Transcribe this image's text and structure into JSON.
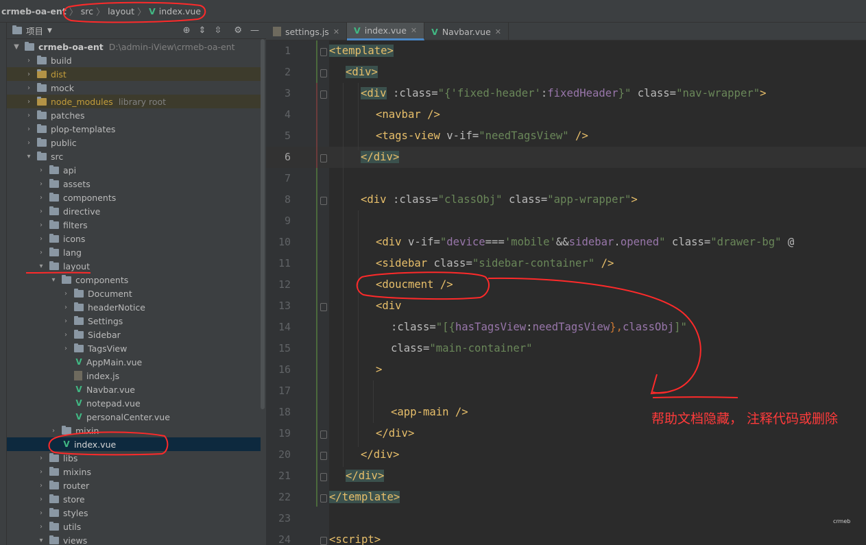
{
  "breadcrumb": {
    "root": "crmeb-oa-ent",
    "src": "src",
    "layout": "layout",
    "file": "index.vue",
    "sep": "〉",
    "file_icon": "V"
  },
  "project": {
    "title": "项目",
    "root_name": "crmeb-oa-ent",
    "root_path": "D:\\admin-iView\\crmeb-oa-ent",
    "items": [
      {
        "label": "build",
        "hint": ""
      },
      {
        "label": "dist",
        "hint": ""
      },
      {
        "label": "mock",
        "hint": ""
      },
      {
        "label": "node_modules",
        "hint": "library root"
      },
      {
        "label": "patches",
        "hint": ""
      },
      {
        "label": "plop-templates",
        "hint": ""
      },
      {
        "label": "public",
        "hint": ""
      },
      {
        "label": "src",
        "hint": ""
      },
      {
        "label": "api",
        "hint": ""
      },
      {
        "label": "assets",
        "hint": ""
      },
      {
        "label": "components",
        "hint": ""
      },
      {
        "label": "directive",
        "hint": ""
      },
      {
        "label": "filters",
        "hint": ""
      },
      {
        "label": "icons",
        "hint": ""
      },
      {
        "label": "lang",
        "hint": ""
      },
      {
        "label": "layout",
        "hint": ""
      },
      {
        "label": "components",
        "hint": ""
      },
      {
        "label": "Document",
        "hint": ""
      },
      {
        "label": "headerNotice",
        "hint": ""
      },
      {
        "label": "Settings",
        "hint": ""
      },
      {
        "label": "Sidebar",
        "hint": ""
      },
      {
        "label": "TagsView",
        "hint": ""
      },
      {
        "label": "AppMain.vue",
        "hint": ""
      },
      {
        "label": "index.js",
        "hint": ""
      },
      {
        "label": "Navbar.vue",
        "hint": ""
      },
      {
        "label": "notepad.vue",
        "hint": ""
      },
      {
        "label": "personalCenter.vue",
        "hint": ""
      },
      {
        "label": "mixin",
        "hint": ""
      },
      {
        "label": "index.vue",
        "hint": ""
      },
      {
        "label": "libs",
        "hint": ""
      },
      {
        "label": "mixins",
        "hint": ""
      },
      {
        "label": "router",
        "hint": ""
      },
      {
        "label": "store",
        "hint": ""
      },
      {
        "label": "styles",
        "hint": ""
      },
      {
        "label": "utils",
        "hint": ""
      },
      {
        "label": "views",
        "hint": ""
      }
    ]
  },
  "tabs": [
    {
      "label": "settings.js"
    },
    {
      "label": "index.vue"
    },
    {
      "label": "Navbar.vue"
    }
  ],
  "lines": [
    "1",
    "2",
    "3",
    "4",
    "5",
    "6",
    "7",
    "8",
    "9",
    "10",
    "11",
    "12",
    "13",
    "14",
    "15",
    "16",
    "17",
    "18",
    "19",
    "20",
    "21",
    "22",
    "23",
    "24"
  ],
  "code": {
    "l1a": "<template>",
    "l2a": "<div>",
    "l3a": "<div",
    "l3b": " :class=",
    "l3c": "\"{",
    "l3d": "'fixed-header'",
    "l3e": ":",
    "l3f": "fixedHeader",
    "l3g": "}\"",
    "l3h": " class=",
    "l3i": "\"nav-wrapper\"",
    "l3j": ">",
    "l4a": "<navbar />",
    "l5a": "<tags-view",
    "l5b": " v-if=",
    "l5c": "\"needTagsView\"",
    "l5d": " />",
    "l6a": "</div>",
    "l8a": "<div",
    "l8b": " :class=",
    "l8c": "\"classObj\"",
    "l8d": " class=",
    "l8e": "\"app-wrapper\"",
    "l8f": ">",
    "l10a": "<div",
    "l10b": " v-if=",
    "l10c": "\"",
    "l10d": "device",
    "l10e": "===",
    "l10f": "'mobile'",
    "l10g": "&&",
    "l10h": "sidebar",
    "l10i": ".",
    "l10j": "opened",
    "l10k": "\"",
    "l10l": " class=",
    "l10m": "\"drawer-bg\"",
    "l10n": " @",
    "l11a": "<sidebar",
    "l11b": " class=",
    "l11c": "\"sidebar-container\"",
    "l11d": " />",
    "l12a": "<doucment />",
    "l13a": "<div",
    "l14a": ":class=",
    "l14b": "\"[{",
    "l14c": "hasTagsView",
    "l14d": ":",
    "l14e": "needTagsView",
    "l14f": "},",
    "l14g": "classObj",
    "l14h": "]\"",
    "l15a": "class=",
    "l15b": "\"main-container\"",
    "l16a": ">",
    "l18a": "<app-main />",
    "l19a": "</div>",
    "l20a": "</div>",
    "l21a": "</div>",
    "l22a": "</template>",
    "l24a": "<script>"
  },
  "annotation": {
    "text": "帮助文档隐藏， 注释代码或删除",
    "color": "#ff3b3b"
  },
  "watermark": "crmeb",
  "colors": {
    "tag": "#e8bf6a",
    "string": "#6a8759",
    "property": "#9876aa",
    "vue_green": "#41b883",
    "selection": "#0d293e"
  }
}
